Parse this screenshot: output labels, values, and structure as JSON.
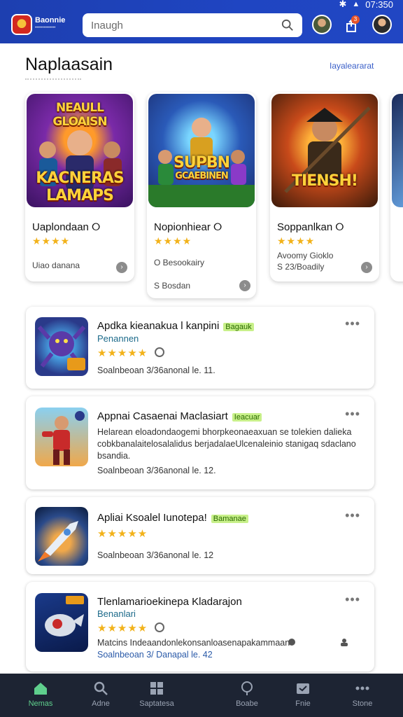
{
  "status": {
    "time": "07:350"
  },
  "header": {
    "logo_text": "Baonnie",
    "logo_sub": "••••••••••••••",
    "search_value": "Inaugh",
    "notif_count": "3"
  },
  "section": {
    "title": "Naplaasain",
    "link": "Iayaleararat"
  },
  "featured": [
    {
      "art_title": "NEAULL GLOAISN KACNERAS LAMAPS",
      "name": "Uaplondaan",
      "stars": "★★★★",
      "meta1": "Uiao danana",
      "meta2": ""
    },
    {
      "art_title": "SUPBN GCAEBINEN",
      "name": "Nopionhiear",
      "stars": "★★★★",
      "meta1": "O Besookairy",
      "meta2": "S Bosdan"
    },
    {
      "art_title": "TIENSH!",
      "name": "Soppanlkan",
      "stars": "★★★★",
      "meta1": "Avoomy Gioklo",
      "meta2": "S 23/Boadily"
    }
  ],
  "list": [
    {
      "title": "Apdka kieanakua l kanpini",
      "tag": "Bagauk",
      "dev": "Penannen",
      "stars": "★★★★★",
      "desc": "",
      "foot": "Soalnbeoan 3/36anonal le. 11."
    },
    {
      "title": "Appnai Casaenai Maclasiart",
      "tag": "Ieacuar",
      "dev": "",
      "stars": "",
      "desc": "Helarean eloadondaogemi bhorpkeonaeaxuan se tolekien dalieka cobkbanalaitelosalalidus berjadalaeUlcenaleinio stanigaq sdaclano bsandia.",
      "foot": "Soalnbeoan 3/36anonal le. 12."
    },
    {
      "title": "Apliai Ksoalel Iunotepa!",
      "tag": "Bamanae",
      "dev": "",
      "stars": "★★★★★",
      "desc": "",
      "foot": "Soalnbeoan 3/36anonal le. 12"
    },
    {
      "title": "Tlenlamarioekinepa Kladarajon",
      "tag": "",
      "dev": "Benanlari",
      "stars": "★★★★★",
      "desc": "Matcins Indeaandonlekonsanloasenapakammaan",
      "foot": "Soalnbeoan 3/ Danapal le. 42"
    }
  ],
  "nav": [
    {
      "label": "Nemas"
    },
    {
      "label": "Adne"
    },
    {
      "label": "Saptatesa"
    },
    {
      "label": "Boabe"
    },
    {
      "label": "Fnie"
    },
    {
      "label": "Stone"
    }
  ]
}
